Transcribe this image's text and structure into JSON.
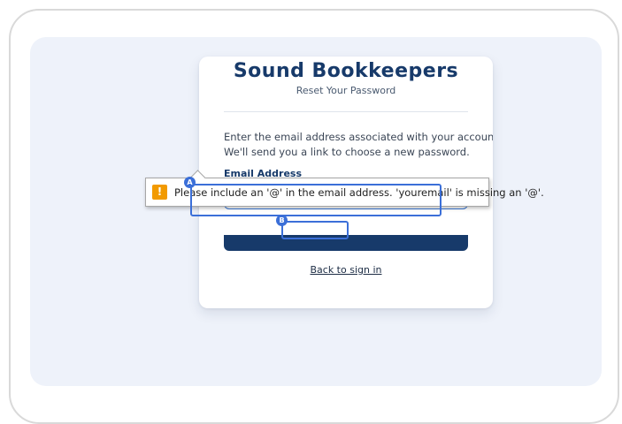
{
  "card": {
    "brand": "Sound Bookkeepers",
    "subtitle": "Reset Your Password",
    "instructions_line1": "Enter the email address associated with your account.",
    "instructions_line2": "We'll send you a link to choose a new password.",
    "email_label": "Email Address",
    "email_value": "youremail",
    "back_link": "Back to sign in"
  },
  "validation_tooltip": {
    "icon": "warning-icon",
    "icon_glyph": "!",
    "message": "Please include an '@' in the email address. 'youremail' is missing an '@'."
  },
  "annotations": {
    "marker_a": "A",
    "marker_b": "B"
  },
  "colors": {
    "brand_navy": "#173a6a",
    "accent_blue": "#3b6fd8",
    "warning_orange": "#f29a00",
    "background": "#eef2fa"
  }
}
